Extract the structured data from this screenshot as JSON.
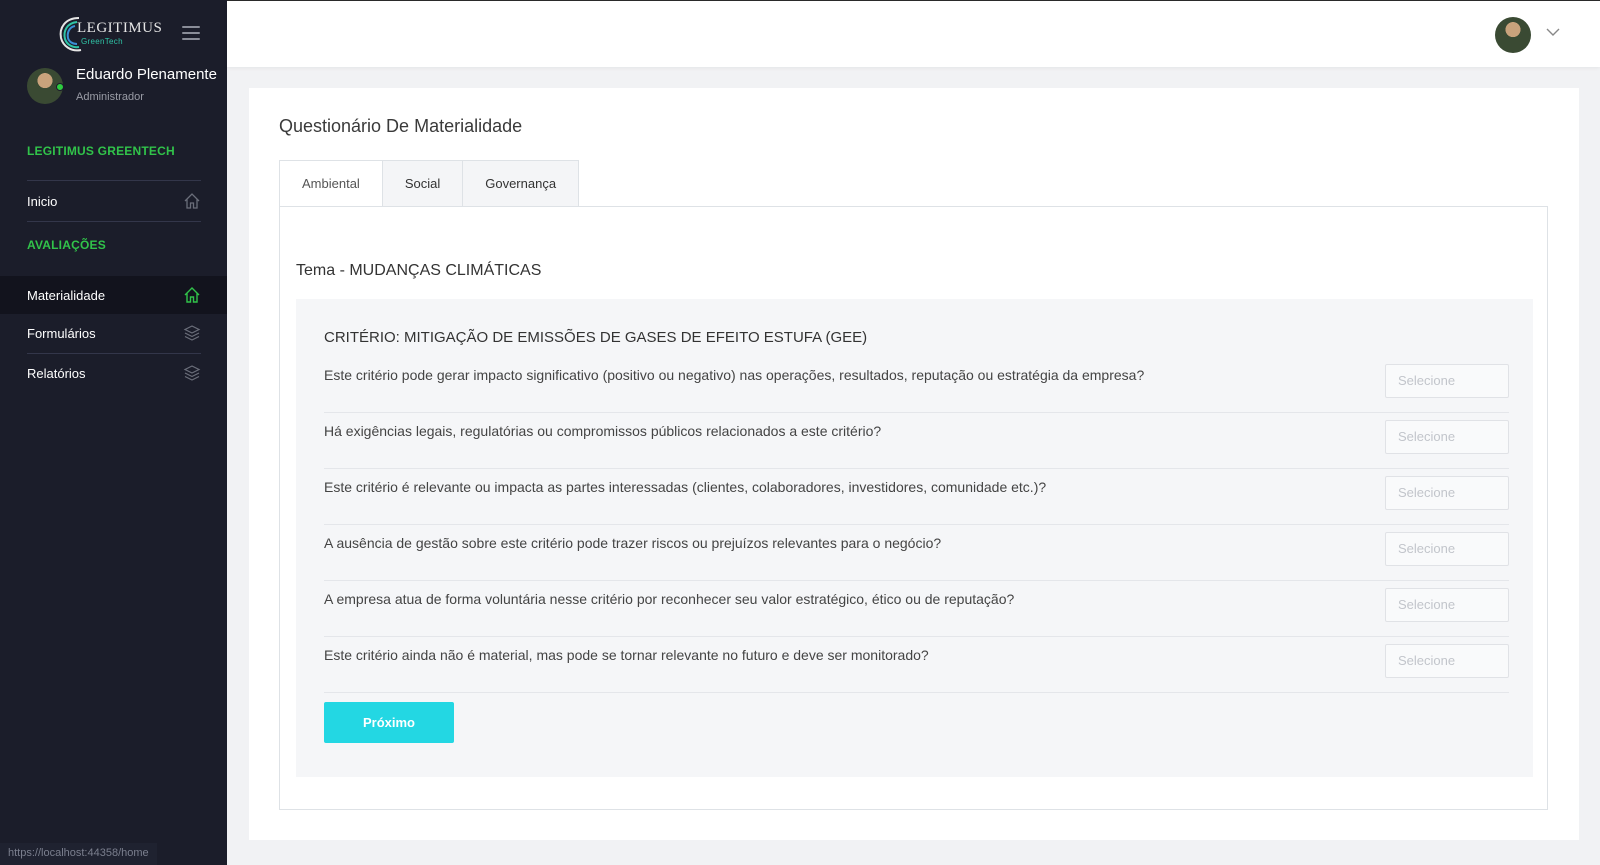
{
  "sidebar": {
    "brand": {
      "name": "LEGITIMUS",
      "sub": "GreenTech"
    },
    "user": {
      "name": "Eduardo Plenamente",
      "role": "Administrador"
    },
    "sections": [
      {
        "label": "LEGITIMUS GREENTECH"
      },
      {
        "label": "AVALIAÇÕES"
      }
    ],
    "items": [
      {
        "label": "Inicio",
        "icon": "home-icon"
      },
      {
        "label": "Materialidade",
        "icon": "home-icon",
        "active": true
      },
      {
        "label": "Formulários",
        "icon": "layers-icon"
      },
      {
        "label": "Relatórios",
        "icon": "layers-icon"
      }
    ],
    "url_hint": "https://localhost:44358/home"
  },
  "colors": {
    "sidebar_bg": "#1b1d2a",
    "accent_green": "#31c34a",
    "button_cyan": "#23d7e3"
  },
  "main": {
    "title": "Questionário De Materialidade",
    "tabs": [
      {
        "label": "Ambiental",
        "active": true
      },
      {
        "label": "Social"
      },
      {
        "label": "Governança"
      }
    ],
    "theme": "Tema - MUDANÇAS CLIMÁTICAS",
    "criterion": "CRITÉRIO: MITIGAÇÃO DE EMISSÕES DE GASES DE EFEITO ESTUFA (GEE)",
    "questions": [
      {
        "text": "Este critério pode gerar impacto significativo (positivo ou negativo) nas operações, resultados, reputação ou estratégia da empresa?",
        "placeholder": "Selecione"
      },
      {
        "text": "Há exigências legais, regulatórias ou compromissos públicos relacionados a este critério?",
        "placeholder": "Selecione"
      },
      {
        "text": "Este critério é relevante ou impacta as partes interessadas (clientes, colaboradores, investidores, comunidade etc.)?",
        "placeholder": "Selecione"
      },
      {
        "text": "A ausência de gestão sobre este critério pode trazer riscos ou prejuízos relevantes para o negócio?",
        "placeholder": "Selecione"
      },
      {
        "text": "A empresa atua de forma voluntária nesse critério por reconhecer seu valor estratégico, ético ou de reputação?",
        "placeholder": "Selecione"
      },
      {
        "text": "Este critério ainda não é material, mas pode se tornar relevante no futuro e deve ser monitorado?",
        "placeholder": "Selecione"
      }
    ],
    "next_label": "Próximo"
  }
}
